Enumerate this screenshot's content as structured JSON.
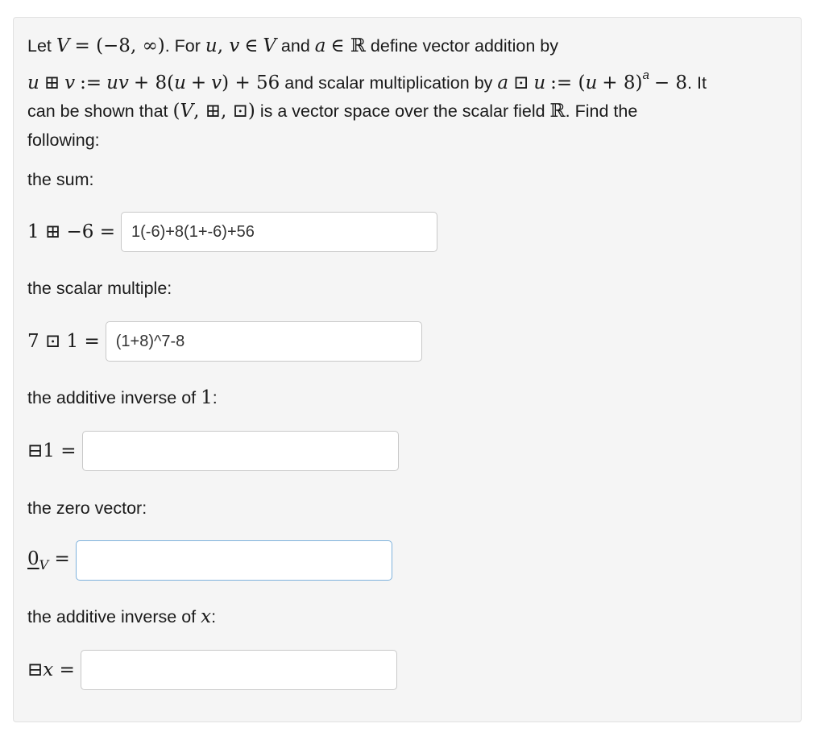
{
  "problem": {
    "intro": "Let V = (−8, ∞). For u, v ∈ V and a ∈ ℝ define vector addition by u ⊞ v := uv + 8(u + v) + 56 and scalar multiplication by a ⊡ u := (u + 8)^a − 8. It can be shown that (V, ⊞, ⊡) is a vector space over the scalar field ℝ. Find the following:"
  },
  "parts": [
    {
      "label": "the sum:",
      "lhs": "1 ⊞ −6 =",
      "value": "1(-6)+8(1+-6)+56"
    },
    {
      "label": "the scalar multiple:",
      "lhs": "7 ⊡ 1 =",
      "value": "(1+8)^7-8"
    },
    {
      "label": "the additive inverse of 1:",
      "lhs": "⊟1 =",
      "value": ""
    },
    {
      "label": "the zero vector:",
      "lhs": "0_V =",
      "value": ""
    },
    {
      "label": "the additive inverse of x:",
      "lhs": "⊟x =",
      "value": ""
    }
  ],
  "colors": {
    "panel": "#f5f5f5",
    "focus_border": "#7fb2dc"
  }
}
